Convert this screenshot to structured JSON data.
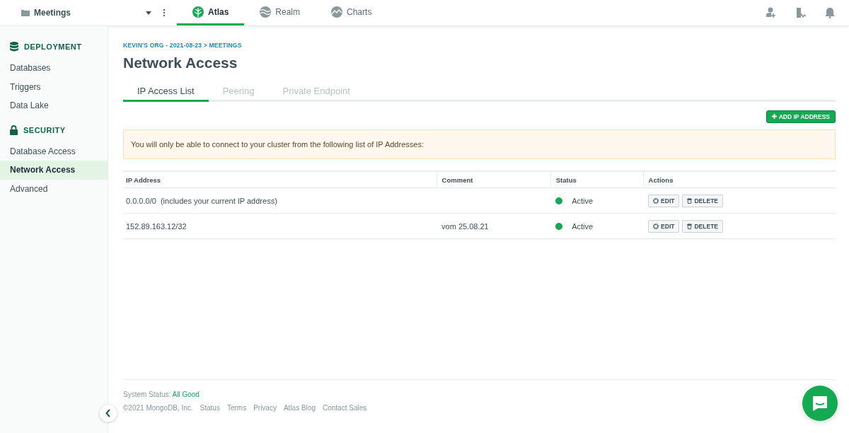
{
  "project": {
    "name": "Meetings"
  },
  "products": [
    {
      "label": "Atlas",
      "kind": "atlas",
      "selected": true
    },
    {
      "label": "Realm",
      "kind": "realm",
      "selected": false
    },
    {
      "label": "Charts",
      "kind": "charts",
      "selected": false
    }
  ],
  "sidebar": {
    "sections": [
      {
        "title": "DEPLOYMENT",
        "kind": "database",
        "items": [
          {
            "label": "Databases",
            "selected": false
          },
          {
            "label": "Triggers",
            "selected": false
          },
          {
            "label": "Data Lake",
            "selected": false
          }
        ]
      },
      {
        "title": "SECURITY",
        "kind": "lock",
        "items": [
          {
            "label": "Database Access",
            "selected": false
          },
          {
            "label": "Network Access",
            "selected": true
          },
          {
            "label": "Advanced",
            "selected": false
          }
        ]
      }
    ]
  },
  "breadcrumb": "KEVIN'S ORG - 2021-08-23 > MEETINGS",
  "title": "Network Access",
  "tabs": [
    {
      "label": "IP Access List",
      "selected": true
    },
    {
      "label": "Peering",
      "selected": false
    },
    {
      "label": "Private Endpoint",
      "selected": false
    }
  ],
  "add_button": "ADD IP ADDRESS",
  "notice": "You will only be able to connect to your cluster from the following list of IP Addresses:",
  "table": {
    "columns": [
      "IP Address",
      "Comment",
      "Status",
      "Actions"
    ],
    "rows": [
      {
        "ip": "0.0.0.0/0  (includes your current IP address)",
        "comment": "",
        "status": "Active",
        "actions": [
          "EDIT",
          "DELETE"
        ]
      },
      {
        "ip": "152.89.163.12/32",
        "comment": "vom 25.08.21",
        "status": "Active",
        "actions": [
          "EDIT",
          "DELETE"
        ]
      }
    ]
  },
  "footer": {
    "status_label": "System Status:",
    "status_value": "All Good",
    "copyright": "©2021 MongoDB, Inc.",
    "links": [
      "Status",
      "Terms",
      "Privacy",
      "Atlas Blog",
      "Contact Sales"
    ]
  }
}
